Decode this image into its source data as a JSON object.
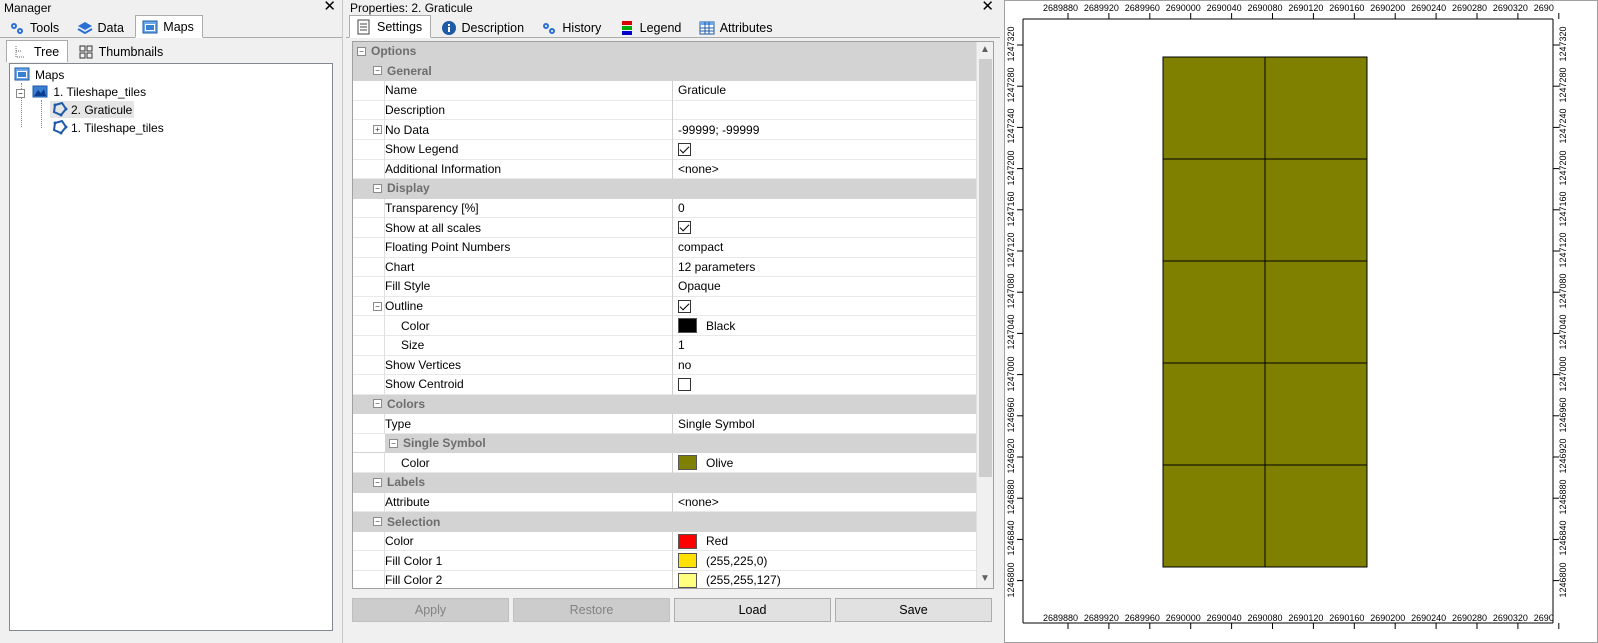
{
  "manager": {
    "title": "Manager",
    "tabs": [
      "Tools",
      "Data",
      "Maps"
    ],
    "active_tab": "Maps",
    "subtabs": [
      "Tree",
      "Thumbnails"
    ],
    "tree": {
      "root": "Maps",
      "map": "1. Tileshape_tiles",
      "layers": [
        "2. Graticule",
        "1. Tileshape_tiles"
      ],
      "selected": "2. Graticule"
    }
  },
  "properties": {
    "title": "Properties: 2. Graticule",
    "tabs": [
      "Settings",
      "Description",
      "History",
      "Legend",
      "Attributes"
    ],
    "active_tab": "Settings",
    "rows": {
      "options": "Options",
      "general": "General",
      "name_label": "Name",
      "name_value": "Graticule",
      "description_label": "Description",
      "description_value": "",
      "nodata_label": "No Data",
      "nodata_value": "-99999; -99999",
      "show_legend_label": "Show Legend",
      "show_legend_checked": true,
      "additional_info_label": "Additional Information",
      "additional_info_value": "<none>",
      "display": "Display",
      "transparency_label": "Transparency [%]",
      "transparency_value": "0",
      "show_all_scales_label": "Show at all scales",
      "show_all_scales_checked": true,
      "float_label": "Floating Point Numbers",
      "float_value": "compact",
      "chart_label": "Chart",
      "chart_value": "12 parameters",
      "fill_style_label": "Fill Style",
      "fill_style_value": "Opaque",
      "outline_label": "Outline",
      "outline_checked": true,
      "outline_color_label": "Color",
      "outline_color_value": "Black",
      "outline_color_hex": "#000000",
      "outline_size_label": "Size",
      "outline_size_value": "1",
      "show_vertices_label": "Show Vertices",
      "show_vertices_value": "no",
      "show_centroid_label": "Show Centroid",
      "show_centroid_checked": false,
      "colors": "Colors",
      "type_label": "Type",
      "type_value": "Single Symbol",
      "single_symbol": "Single Symbol",
      "symbol_color_label": "Color",
      "symbol_color_value": "Olive",
      "symbol_color_hex": "#808000",
      "labels": "Labels",
      "attribute_label": "Attribute",
      "attribute_value": "<none>",
      "selection": "Selection",
      "sel_color_label": "Color",
      "sel_color_value": "Red",
      "sel_color_hex": "#ff0000",
      "fill1_label": "Fill Color 1",
      "fill1_value": "(255,225,0)",
      "fill1_hex": "#ffe100",
      "fill2_label": "Fill Color 2",
      "fill2_value": "(255,255,127)",
      "fill2_hex": "#ffff7f"
    },
    "buttons": {
      "apply": "Apply",
      "restore": "Restore",
      "load": "Load",
      "save": "Save"
    }
  },
  "map": {
    "x_ticks": [
      "2689880",
      "2689920",
      "2689960",
      "2690000",
      "2690040",
      "2690080",
      "2690120",
      "2690160",
      "2690200",
      "2690240",
      "2690280",
      "2690320",
      "2690"
    ],
    "y_ticks": [
      "1247320",
      "1247280",
      "1247240",
      "1247200",
      "1247160",
      "1247120",
      "1247080",
      "1247040",
      "1247000",
      "1246960",
      "1246920",
      "1246880",
      "1246840",
      "1246800"
    ],
    "grid": {
      "cols": 2,
      "rows": 5
    },
    "fill_color": "#808000",
    "outline_color": "#000000"
  }
}
